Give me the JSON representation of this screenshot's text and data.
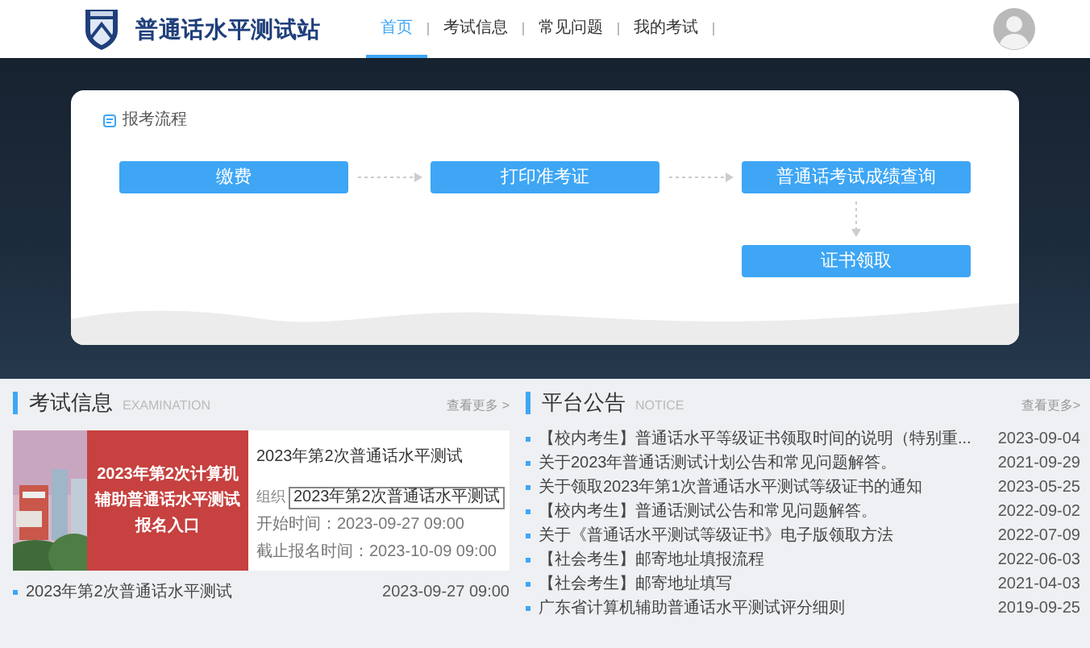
{
  "header": {
    "site_title": "普通话水平测试站",
    "nav": [
      {
        "label": "首页",
        "selected": true
      },
      {
        "label": "考试信息",
        "selected": false
      },
      {
        "label": "常见问题",
        "selected": false
      },
      {
        "label": "我的考试",
        "selected": false
      }
    ]
  },
  "process": {
    "title": "报考流程",
    "steps": [
      "缴费",
      "打印准考证",
      "普通话考试成绩查询",
      "证书领取"
    ]
  },
  "exam_info": {
    "title": "考试信息",
    "subtitle": "EXAMINATION",
    "more": "查看更多 >",
    "featured": {
      "banner_text": "2023年第2次计算机辅助普通话水平测试报名入口",
      "title": "2023年第2次普通话水平测试",
      "organizer_label": "组织",
      "tooltip": "2023年第2次普通话水平测试",
      "start": "开始时间：2023-09-27 09:00",
      "deadline": "截止报名时间：2023-10-09 09:00"
    },
    "items": [
      {
        "title": "2023年第2次普通话水平测试",
        "date": "2023-09-27 09:00"
      }
    ]
  },
  "notice": {
    "title": "平台公告",
    "subtitle": "NOTICE",
    "more": "查看更多>",
    "items": [
      {
        "title": "【校内考生】普通话水平等级证书领取时间的说明（特别重...",
        "date": "2023-09-04"
      },
      {
        "title": "关于2023年普通话测试计划公告和常见问题解答。",
        "date": "2021-09-29"
      },
      {
        "title": "关于领取2023年第1次普通话水平测试等级证书的通知",
        "date": "2023-05-25"
      },
      {
        "title": "【校内考生】普通话测试公告和常见问题解答。",
        "date": "2022-09-02"
      },
      {
        "title": "关于《普通话水平测试等级证书》电子版领取方法",
        "date": "2022-07-09"
      },
      {
        "title": "【社会考生】邮寄地址填报流程",
        "date": "2022-06-03"
      },
      {
        "title": "【社会考生】邮寄地址填写",
        "date": "2021-04-03"
      },
      {
        "title": "广东省计算机辅助普通话水平测试评分细则",
        "date": "2019-09-25"
      }
    ]
  }
}
